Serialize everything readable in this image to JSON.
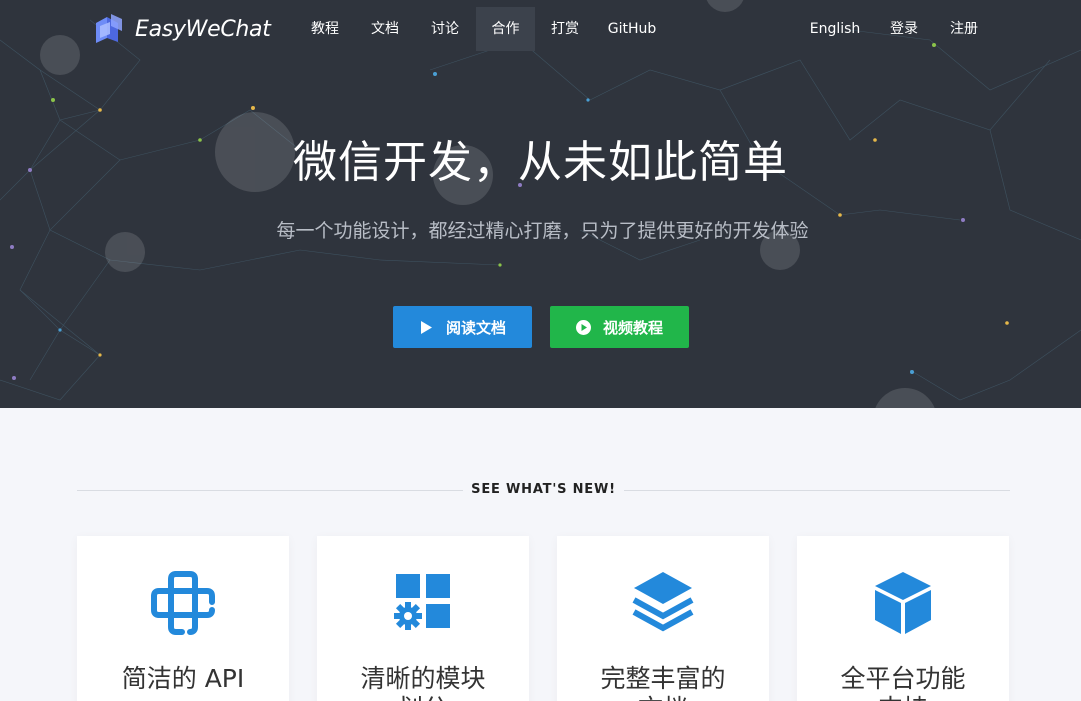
{
  "brand": {
    "name": "EasyWeChat"
  },
  "nav": {
    "items": [
      {
        "label": "教程"
      },
      {
        "label": "文档"
      },
      {
        "label": "讨论"
      },
      {
        "label": "合作",
        "active": true
      },
      {
        "label": "打赏"
      },
      {
        "label": "GitHub"
      }
    ],
    "right": [
      {
        "label": "English"
      },
      {
        "label": "登录"
      },
      {
        "label": "注册"
      }
    ]
  },
  "hero": {
    "title": "微信开发，从未如此简单",
    "subtitle": "每一个功能设计，都经过精心打磨，只为了提供更好的开发体验",
    "buttons": [
      {
        "label": "阅读文档",
        "icon": "play-triangle-icon",
        "color": "#2389db"
      },
      {
        "label": "视频教程",
        "icon": "play-circle-icon",
        "color": "#21b64a"
      }
    ]
  },
  "section": {
    "heading": "SEE WHAT'S NEW!"
  },
  "features": [
    {
      "title": "简洁的 API",
      "icon": "cross-link-icon"
    },
    {
      "title": "清晰的模块划分",
      "icon": "modules-gear-icon"
    },
    {
      "title": "完整丰富的文档",
      "icon": "layers-icon"
    },
    {
      "title": "全平台功能支持",
      "icon": "cube-icon"
    }
  ],
  "colors": {
    "hero_bg": "#2f343d",
    "accent_blue": "#2389db",
    "accent_green": "#21b64a",
    "page_bg": "#f5f6fa"
  }
}
